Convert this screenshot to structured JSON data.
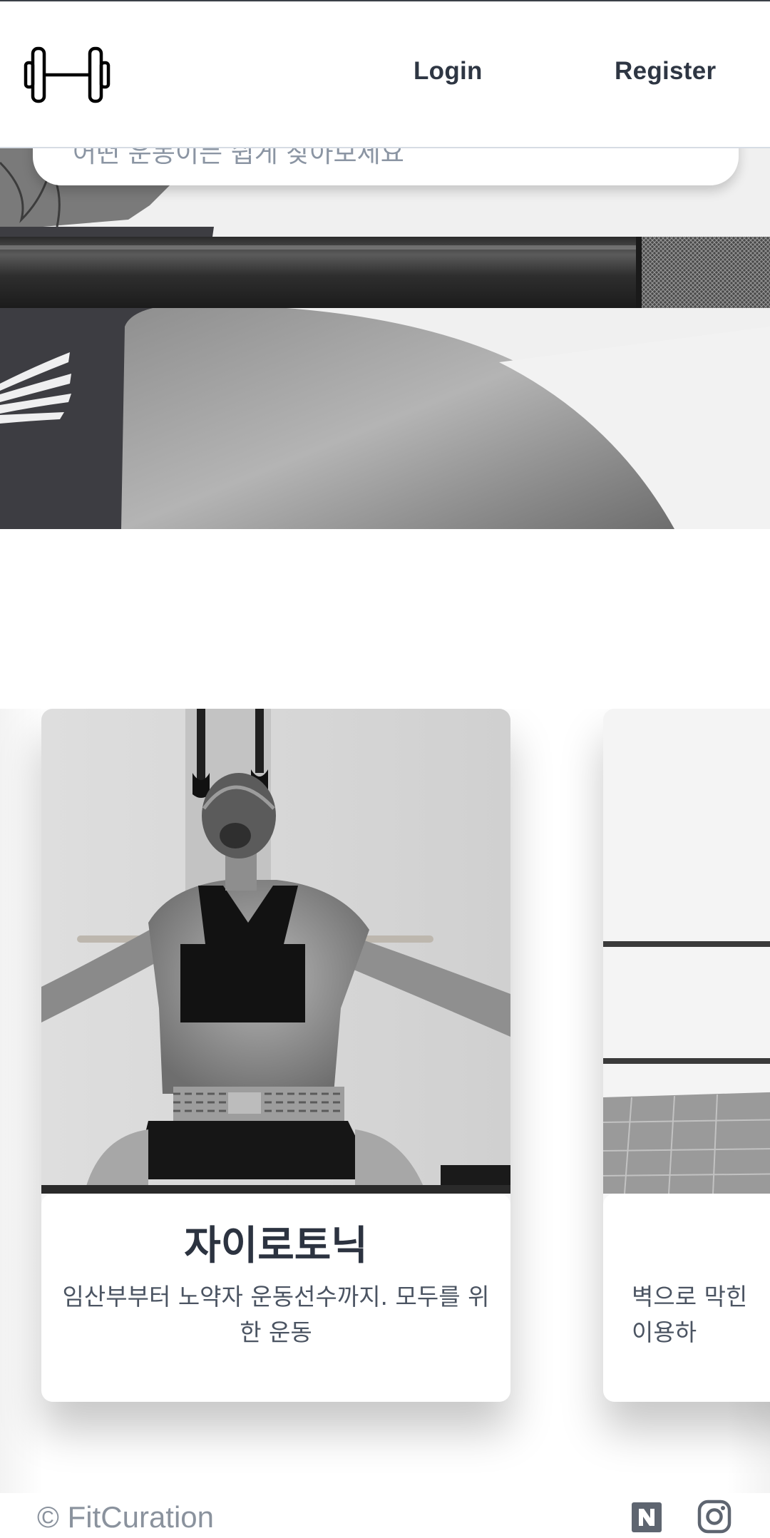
{
  "header": {
    "logo_icon": "dumbbell-icon",
    "login_label": "Login",
    "register_label": "Register"
  },
  "hero": {
    "search_text": "어떤 운동이든 쉽게 찾아보세요",
    "image": "barbell-shoulder-photo"
  },
  "cards": [
    {
      "title": "자이로토닉",
      "description": "임산부부터 노약자 운동선수까지. 모두를 위한 운동",
      "image": "gyrotonic-back-photo"
    },
    {
      "title": "",
      "description": "벽으로 막힌 \n이용하",
      "image": "studio-room-photo"
    }
  ],
  "footer": {
    "copyright": "© FitCuration",
    "naver_icon": "naver-icon",
    "instagram_icon": "instagram-icon"
  },
  "colors": {
    "text_dark": "#2e3643",
    "text_muted": "#8a929d",
    "border": "#d6dce4"
  }
}
